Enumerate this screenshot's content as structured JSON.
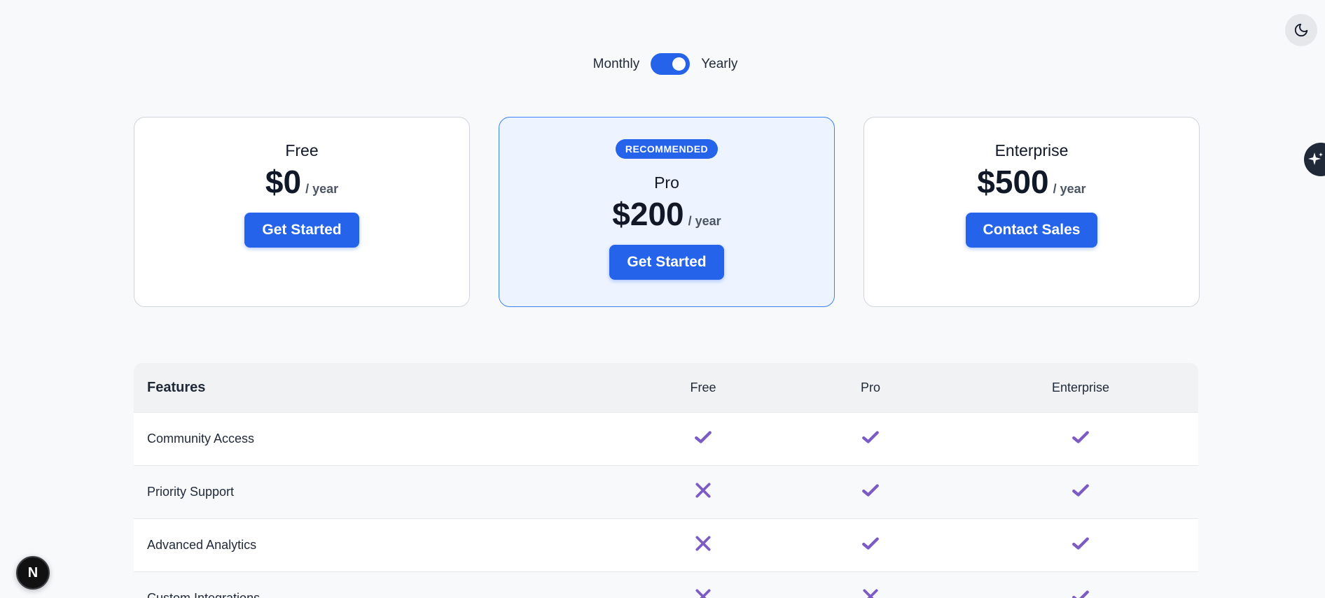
{
  "billing": {
    "monthly_label": "Monthly",
    "yearly_label": "Yearly",
    "yearly_selected": true
  },
  "plans": [
    {
      "name": "Free",
      "price": "$0",
      "period": "/ year",
      "cta": "Get Started",
      "recommended": false
    },
    {
      "name": "Pro",
      "price": "$200",
      "period": "/ year",
      "cta": "Get Started",
      "recommended": true,
      "badge": "RECOMMENDED"
    },
    {
      "name": "Enterprise",
      "price": "$500",
      "period": "/ year",
      "cta": "Contact Sales",
      "recommended": false
    }
  ],
  "table": {
    "headers": [
      "Features",
      "Free",
      "Pro",
      "Enterprise"
    ],
    "rows": [
      {
        "feature": "Community Access",
        "values": [
          true,
          true,
          true
        ]
      },
      {
        "feature": "Priority Support",
        "values": [
          false,
          true,
          true
        ]
      },
      {
        "feature": "Advanced Analytics",
        "values": [
          false,
          true,
          true
        ]
      },
      {
        "feature": "Custom Integrations",
        "values": [
          false,
          false,
          true
        ]
      }
    ]
  },
  "icons": {
    "theme": "moon-icon",
    "assistant": "sparkle-icon",
    "framework": "next-logo",
    "included": "check-icon",
    "excluded": "x-icon"
  },
  "colors": {
    "accent": "#2563eb",
    "mark": "#7c5cc4"
  },
  "framework_badge": "N"
}
